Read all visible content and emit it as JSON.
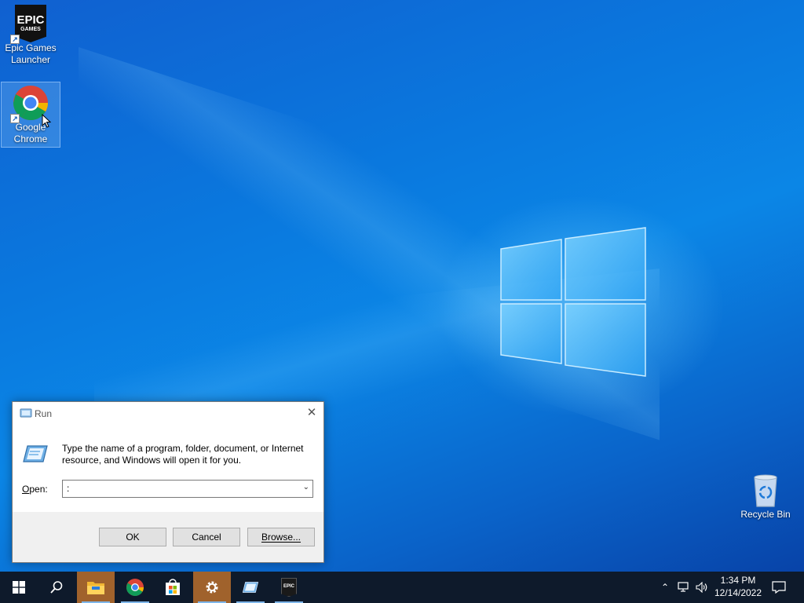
{
  "desktop": {
    "icons": [
      {
        "label_line1": "Epic Games",
        "label_line2": "Launcher",
        "badge_line1": "EPIC",
        "badge_line2": "GAMES"
      },
      {
        "label_line1": "Google",
        "label_line2": "Chrome"
      },
      {
        "label_line1": "Recycle Bin"
      }
    ]
  },
  "run_dialog": {
    "title": "Run",
    "description": "Type the name of a program, folder, document, or Internet resource, and Windows will open it for you.",
    "open_label_prefix": "O",
    "open_label_rest": "pen:",
    "open_value": ":",
    "ok": "OK",
    "cancel": "Cancel",
    "browse": "Browse..."
  },
  "taskbar": {
    "apps": [
      "start",
      "search",
      "file-explorer",
      "chrome",
      "microsoft-store",
      "settings",
      "run",
      "epic-games"
    ],
    "epic_label": "EPIC",
    "time": "1:34 PM",
    "date": "12/14/2022"
  },
  "colors": {
    "taskbar": "#0e1a2b",
    "active_taskbar_item": "#a0622c",
    "desktop_blue": "#0b86e6"
  }
}
